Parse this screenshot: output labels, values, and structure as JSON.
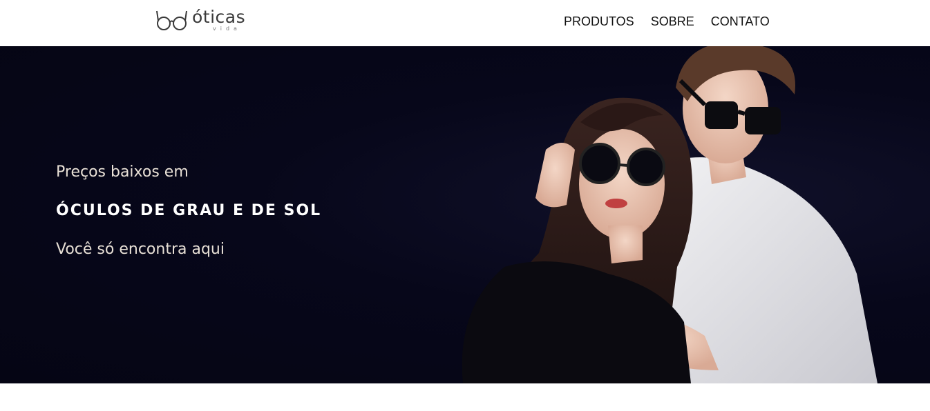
{
  "brand": {
    "name": "óticas",
    "sub": "vida",
    "logo_icon": "glasses-icon"
  },
  "nav": {
    "items": [
      {
        "label": "PRODUTOS"
      },
      {
        "label": "SOBRE"
      },
      {
        "label": "CONTATO"
      }
    ]
  },
  "hero": {
    "line1": "Preços baixos em",
    "line2": "ÓCULOS DE GRAU E DE SOL",
    "line3": "Você só encontra aqui",
    "photo": "couple-wearing-sunglasses",
    "background": "#07071a"
  }
}
